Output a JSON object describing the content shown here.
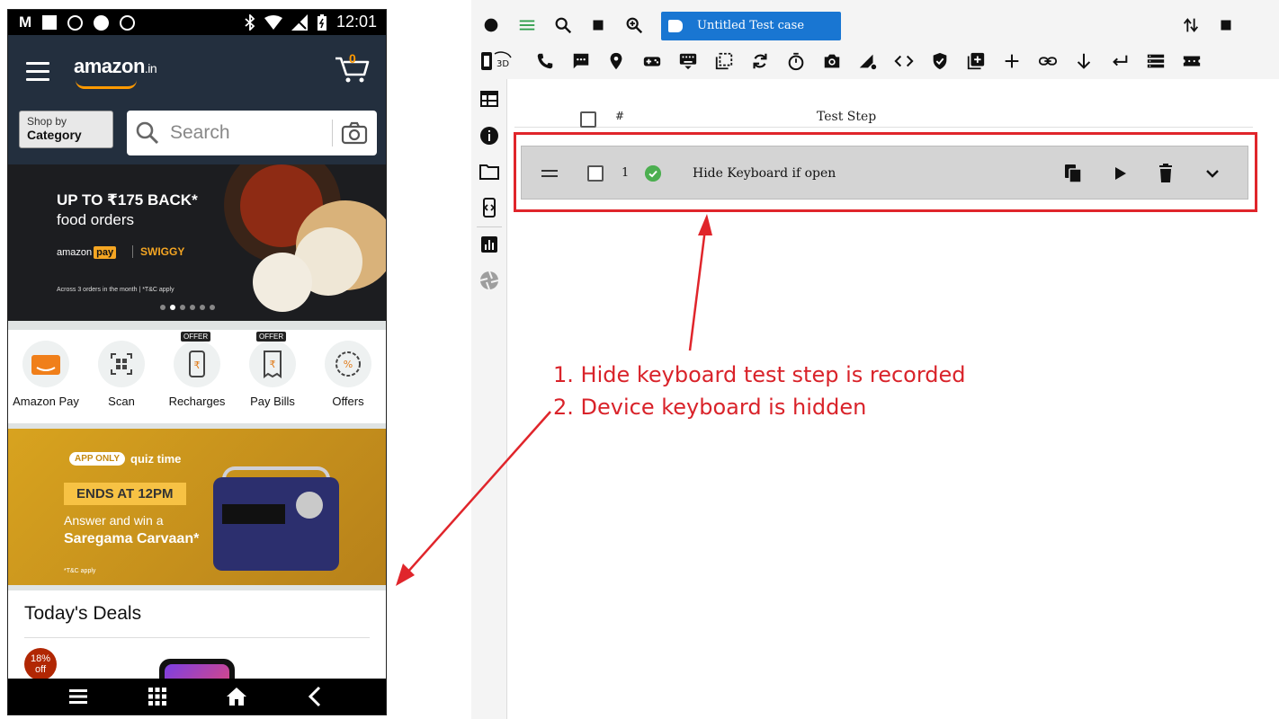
{
  "phone": {
    "status_bar": {
      "carrier_icon": "M",
      "time": "12:01"
    },
    "header": {
      "logo_text": "amazon",
      "logo_suffix": ".in",
      "cart_count": "0"
    },
    "shop_by": {
      "line1": "Shop by",
      "line2": "Category"
    },
    "search": {
      "placeholder": "Search"
    },
    "banner_food": {
      "line1": "UP TO ₹175 BACK*",
      "line2": "food orders",
      "pay_label": "amazon",
      "pay_badge": "pay",
      "partner": "SWIGGY",
      "fine_print": "Across 3 orders in the month | *T&C apply"
    },
    "quick_actions": [
      {
        "label": "Amazon Pay",
        "icon": "amazon-pay-icon",
        "offer": ""
      },
      {
        "label": "Scan",
        "icon": "qr-scan-icon",
        "offer": ""
      },
      {
        "label": "Recharges",
        "icon": "mobile-recharge-icon",
        "offer": "OFFER"
      },
      {
        "label": "Pay Bills",
        "icon": "bill-icon",
        "offer": "OFFER"
      },
      {
        "label": "Offers",
        "icon": "percent-badge-icon",
        "offer": ""
      }
    ],
    "banner_quiz": {
      "app_only": "APP ONLY",
      "quiz_time": "quiz time",
      "ends": "ENDS AT 12PM",
      "answer": "Answer and win a",
      "prize": "Saregama Carvaan*",
      "tc": "*T&C apply"
    },
    "deals": {
      "title": "Today's Deals",
      "badge_pct": "18%",
      "badge_off": "off"
    }
  },
  "tool": {
    "test_case_tab": "Untitled Test case",
    "table": {
      "col_hash": "#",
      "col_step": "Test Step",
      "rows": [
        {
          "num": "1",
          "step": "Hide Keyboard if open",
          "status": "passed"
        }
      ]
    },
    "toolbar_3d_label": "3D"
  },
  "annotations": {
    "line1": "1. Hide keyboard test step is recorded",
    "line2": "2. Device keyboard is hidden",
    "color": "#d9232a"
  },
  "colors": {
    "amazon_header": "#232f3e",
    "amazon_orange": "#ff9900",
    "tab_blue": "#1976d2",
    "pass_green": "#4caf50",
    "highlight_red": "#e0252b"
  }
}
